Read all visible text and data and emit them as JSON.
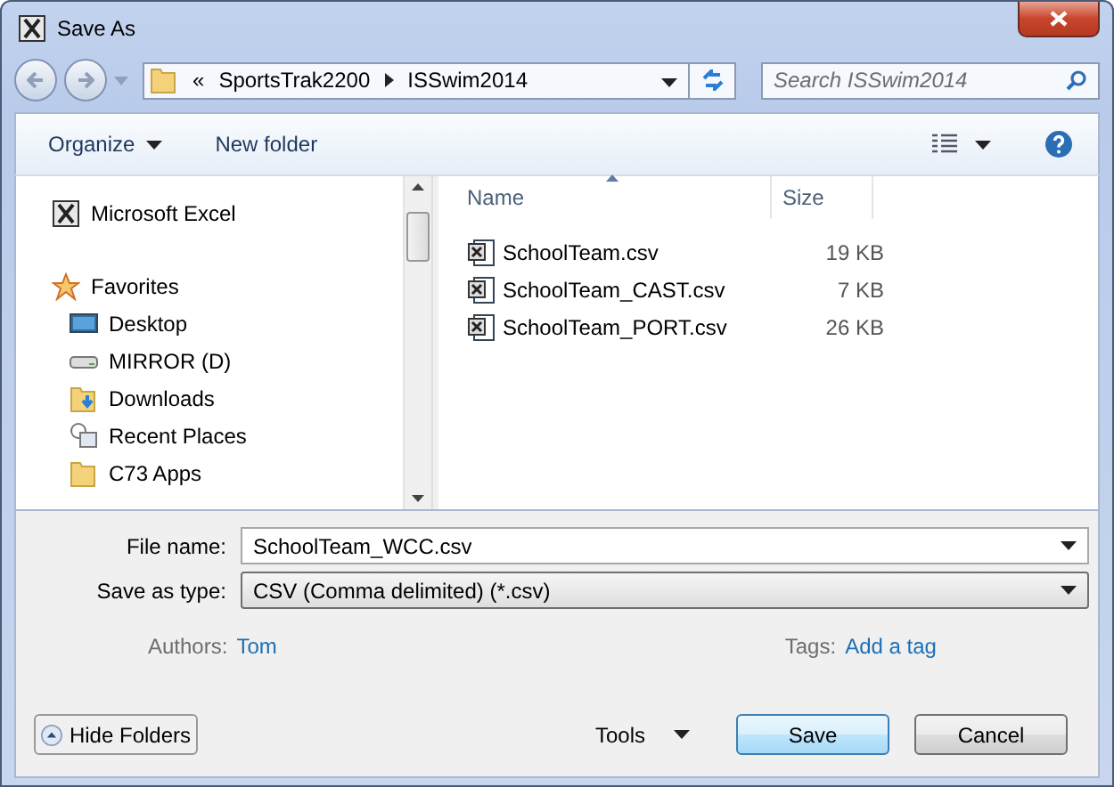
{
  "window": {
    "title": "Save As"
  },
  "address_bar": {
    "overflow": "«",
    "path": [
      "SportsTrak2200",
      "ISSwim2014"
    ]
  },
  "search": {
    "placeholder": "Search ISSwim2014"
  },
  "toolbar": {
    "items": [
      "Organize",
      "New folder"
    ]
  },
  "navigation": {
    "items": [
      {
        "label": "Microsoft Excel",
        "kind": "excel"
      },
      {
        "label": "Favorites",
        "kind": "header"
      },
      {
        "label": "Desktop",
        "kind": "desktop"
      },
      {
        "label": "MIRROR (D)",
        "kind": "drive"
      },
      {
        "label": "Downloads",
        "kind": "downloads"
      },
      {
        "label": "Recent Places",
        "kind": "recent"
      },
      {
        "label": "C73 Apps",
        "kind": "folder"
      }
    ]
  },
  "files": {
    "columns": [
      "Name",
      "Size"
    ],
    "rows": [
      {
        "name": "SchoolTeam.csv",
        "size": "19 KB"
      },
      {
        "name": "SchoolTeam_CAST.csv",
        "size": "7 KB"
      },
      {
        "name": "SchoolTeam_PORT.csv",
        "size": "26 KB"
      }
    ]
  },
  "form": {
    "file_name": {
      "label": "File name:",
      "value": "SchoolTeam_WCC.csv"
    },
    "save_as_type": {
      "label": "Save as type:",
      "value": "CSV (Comma delimited) (*.csv)"
    },
    "authors": {
      "label": "Authors:",
      "value": "Tom"
    },
    "tags": {
      "label": "Tags:",
      "value": "Add a tag"
    }
  },
  "buttons": {
    "hide_folders": "Hide Folders",
    "tools": "Tools",
    "save": "Save",
    "cancel": "Cancel"
  }
}
